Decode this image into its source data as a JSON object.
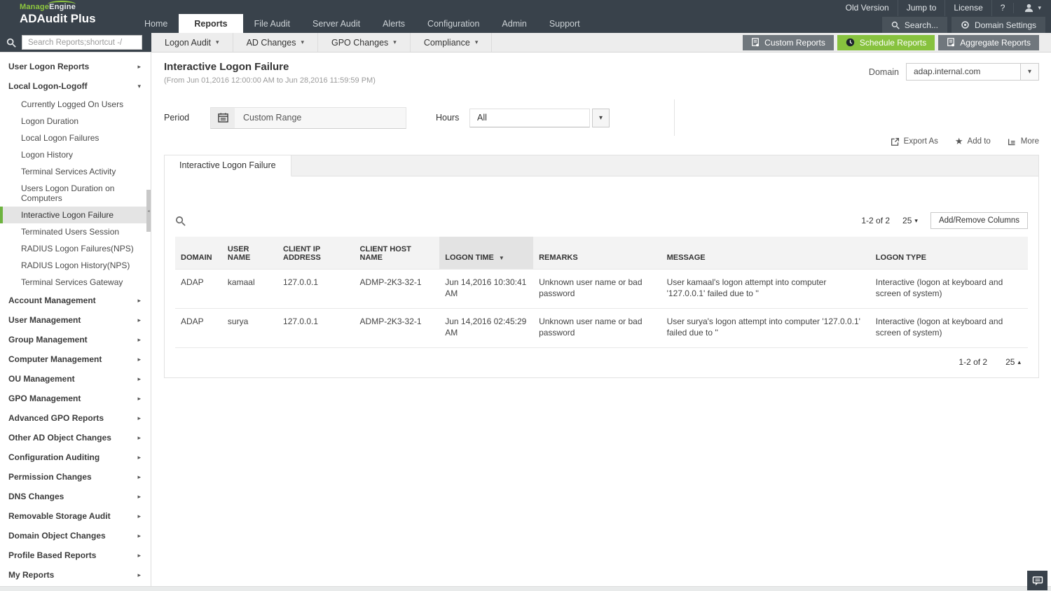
{
  "colors": {
    "header_bg": "#39424b",
    "header_button_bg": "#49525a",
    "accent_green": "#87c23e",
    "brand_green": "#8dc63f",
    "sidebar_selected_bar": "#6db33f",
    "gray_button": "#70777d",
    "table_header_bg": "#f3f3f3",
    "sorted_column_bg": "#e3e3e3"
  },
  "brand": {
    "manage": "Manage",
    "engine": "Engine",
    "product": "ADAudit Plus"
  },
  "header": {
    "utility": [
      "Old Version",
      "Jump to",
      "License",
      "?"
    ],
    "nav": [
      {
        "label": "Home",
        "active": false
      },
      {
        "label": "Reports",
        "active": true
      },
      {
        "label": "File Audit",
        "active": false
      },
      {
        "label": "Server Audit",
        "active": false
      },
      {
        "label": "Alerts",
        "active": false
      },
      {
        "label": "Configuration",
        "active": false
      },
      {
        "label": "Admin",
        "active": false
      },
      {
        "label": "Support",
        "active": false
      }
    ],
    "search_label": "Search...",
    "domain_settings_label": "Domain Settings"
  },
  "toolbar": {
    "search_placeholder": "Search Reports;shortcut -/",
    "menus": [
      "Logon Audit",
      "AD Changes",
      "GPO Changes",
      "Compliance"
    ],
    "buttons": [
      {
        "label": "Custom Reports",
        "style": "gray"
      },
      {
        "label": "Schedule Reports",
        "style": "green"
      },
      {
        "label": "Aggregate Reports",
        "style": "gray"
      }
    ]
  },
  "sidebar": {
    "items": [
      {
        "label": "User Logon Reports",
        "type": "section",
        "expanded": false
      },
      {
        "label": "Local Logon-Logoff",
        "type": "section",
        "expanded": true
      },
      {
        "label": "Currently Logged On Users",
        "type": "sub"
      },
      {
        "label": "Logon Duration",
        "type": "sub"
      },
      {
        "label": "Local Logon Failures",
        "type": "sub"
      },
      {
        "label": "Logon History",
        "type": "sub"
      },
      {
        "label": "Terminal Services Activity",
        "type": "sub"
      },
      {
        "label": "Users Logon Duration on Computers",
        "type": "sub"
      },
      {
        "label": "Interactive Logon Failure",
        "type": "sub",
        "selected": true
      },
      {
        "label": "Terminated Users Session",
        "type": "sub"
      },
      {
        "label": "RADIUS Logon Failures(NPS)",
        "type": "sub"
      },
      {
        "label": "RADIUS Logon History(NPS)",
        "type": "sub"
      },
      {
        "label": "Terminal Services Gateway",
        "type": "sub"
      },
      {
        "label": "Account Management",
        "type": "section",
        "expanded": false
      },
      {
        "label": "User Management",
        "type": "section",
        "expanded": false
      },
      {
        "label": "Group Management",
        "type": "section",
        "expanded": false
      },
      {
        "label": "Computer Management",
        "type": "section",
        "expanded": false
      },
      {
        "label": "OU Management",
        "type": "section",
        "expanded": false
      },
      {
        "label": "GPO Management",
        "type": "section",
        "expanded": false
      },
      {
        "label": "Advanced GPO Reports",
        "type": "section",
        "expanded": false
      },
      {
        "label": "Other AD Object Changes",
        "type": "section",
        "expanded": false
      },
      {
        "label": "Configuration Auditing",
        "type": "section",
        "expanded": false
      },
      {
        "label": "Permission Changes",
        "type": "section",
        "expanded": false
      },
      {
        "label": "DNS Changes",
        "type": "section",
        "expanded": false
      },
      {
        "label": "Removable Storage Audit",
        "type": "section",
        "expanded": false
      },
      {
        "label": "Domain Object Changes",
        "type": "section",
        "expanded": false
      },
      {
        "label": "Profile Based Reports",
        "type": "section",
        "expanded": false
      },
      {
        "label": "My Reports",
        "type": "section",
        "expanded": false
      }
    ]
  },
  "report": {
    "title": "Interactive Logon Failure",
    "subtitle": "(From Jun 01,2016 12:00:00 AM to Jun 28,2016 11:59:59 PM)",
    "domain_label": "Domain",
    "domain_value": "adap.internal.com",
    "period_label": "Period",
    "period_value": "Custom Range",
    "hours_label": "Hours",
    "hours_value": "All",
    "links": [
      "Export As",
      "Add to",
      "More"
    ],
    "tab_label": "Interactive Logon Failure",
    "add_remove_columns": "Add/Remove Columns",
    "pagination": {
      "range": "1-2 of 2",
      "page_size": "25"
    }
  },
  "table": {
    "columns": [
      "DOMAIN",
      "USER NAME",
      "CLIENT IP ADDRESS",
      "CLIENT HOST NAME",
      "LOGON TIME",
      "REMARKS",
      "MESSAGE",
      "LOGON TYPE"
    ],
    "sorted_column": "LOGON TIME",
    "sort_direction": "desc",
    "rows": [
      [
        "ADAP",
        "kamaal",
        "127.0.0.1",
        "ADMP-2K3-32-1",
        "Jun 14,2016 10:30:41 AM",
        "Unknown user name or bad password",
        "User kamaal's logon attempt into computer '127.0.0.1' failed due to ''",
        "Interactive (logon at keyboard and screen of system)"
      ],
      [
        "ADAP",
        "surya",
        "127.0.0.1",
        "ADMP-2K3-32-1",
        "Jun 14,2016 02:45:29 AM",
        "Unknown user name or bad password",
        "User surya's logon attempt into computer '127.0.0.1' failed due to ''",
        "Interactive (logon at keyboard and screen of system)"
      ]
    ]
  }
}
